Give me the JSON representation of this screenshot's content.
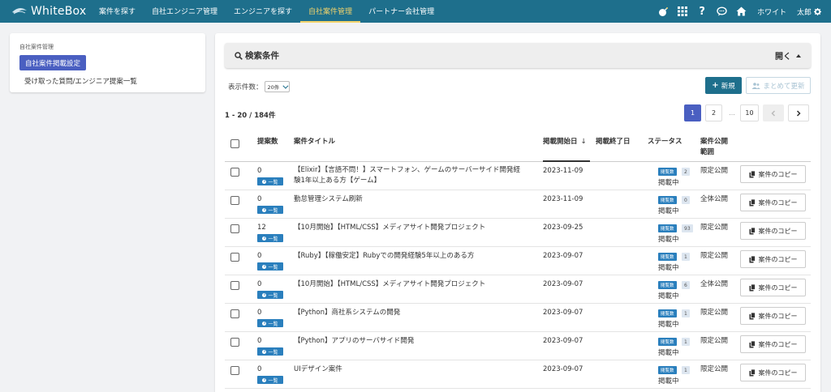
{
  "nav": {
    "brand": "WhiteBox",
    "items": [
      {
        "label": "案件を探す",
        "active": false
      },
      {
        "label": "自社エンジニア管理",
        "active": false
      },
      {
        "label": "エンジニアを探す",
        "active": false
      },
      {
        "label": "自社案件管理",
        "active": true
      },
      {
        "label": "パートナー会社管理",
        "active": false
      }
    ],
    "user_name": "ホワイト",
    "user_given": "太郎",
    "icons": [
      "bomb-icon",
      "grid-icon",
      "help-icon",
      "chat-icon",
      "home-icon",
      "gear-icon"
    ]
  },
  "sidebar": {
    "title": "自社案件管理",
    "items": [
      {
        "label": "自社案件掲載設定",
        "active": true
      },
      {
        "label": "受け取った質問/エンジニア提案一覧",
        "active": false
      }
    ]
  },
  "search": {
    "title": "検索条件",
    "toggle": "開く"
  },
  "toolbar": {
    "per_page_label": "表示件数：",
    "per_page_value": "20件",
    "new_label": "新規",
    "bulk_label": "まとめて更新"
  },
  "list": {
    "count": "1 - 20 / 184件"
  },
  "pagination": {
    "pages": [
      "1",
      "2",
      "...",
      "10"
    ],
    "current": "1"
  },
  "table": {
    "headers": {
      "proposals": "提案数",
      "title": "案件タイトル",
      "start": "掲載開始日",
      "sort_arrow": "↓",
      "end": "掲載終了日",
      "status": "ステータス",
      "scope_line1": "案件公開",
      "scope_line2": "範囲"
    },
    "list_badge": "一覧",
    "copy_label": "案件のコピー",
    "rows": [
      {
        "proposals": "0",
        "title_line1": "【Elixir】【言語不問！】スマートフォン、ゲームのサーバーサイド開発経",
        "title_line2": "験1年以上ある方【ゲーム】",
        "start": "2023-11-09",
        "end": "",
        "badge": "閲覧数",
        "views": "2",
        "status": "掲載中",
        "scope": "限定公開"
      },
      {
        "proposals": "0",
        "title_line1": "勤怠管理システム刷新",
        "title_line2": "",
        "start": "2023-11-09",
        "end": "",
        "badge": "閲覧数",
        "views": "0",
        "status": "掲載中",
        "scope": "全体公開"
      },
      {
        "proposals": "12",
        "title_line1": "【10月開始】【HTML/CSS】メディアサイト開発プロジェクト",
        "title_line2": "",
        "start": "2023-09-25",
        "end": "",
        "badge": "閲覧数",
        "views": "93",
        "status": "掲載中",
        "scope": "限定公開"
      },
      {
        "proposals": "0",
        "title_line1": "【Ruby】【稼働安定】Rubyでの開発経験5年以上のある方",
        "title_line2": "",
        "start": "2023-09-07",
        "end": "",
        "badge": "閲覧数",
        "views": "1",
        "status": "掲載中",
        "scope": "限定公開"
      },
      {
        "proposals": "0",
        "title_line1": "【10月開始】【HTML/CSS】メディアサイト開発プロジェクト",
        "title_line2": "",
        "start": "2023-09-07",
        "end": "",
        "badge": "閲覧数",
        "views": "6",
        "status": "掲載中",
        "scope": "全体公開"
      },
      {
        "proposals": "0",
        "title_line1": "【Python】商社系システムの開発",
        "title_line2": "",
        "start": "2023-09-07",
        "end": "",
        "badge": "閲覧数",
        "views": "1",
        "status": "掲載中",
        "scope": "限定公開"
      },
      {
        "proposals": "0",
        "title_line1": "【Python】アプリのサーバサイド開発",
        "title_line2": "",
        "start": "2023-09-07",
        "end": "",
        "badge": "閲覧数",
        "views": "1",
        "status": "掲載中",
        "scope": "限定公開"
      },
      {
        "proposals": "0",
        "title_line1": "UIデザイン案件",
        "title_line2": "",
        "start": "2023-09-07",
        "end": "",
        "badge": "閲覧数",
        "views": "1",
        "status": "掲載中",
        "scope": "限定公開"
      }
    ]
  },
  "colors": {
    "nav_bg": "#1e6f8c",
    "nav_active": "#f2d36b",
    "primary": "#4a5fc1",
    "badge": "#2a7fbd"
  }
}
